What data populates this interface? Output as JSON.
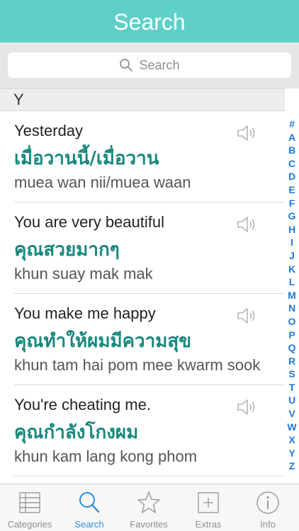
{
  "header": {
    "title": "Search"
  },
  "search": {
    "placeholder": "Search"
  },
  "section": {
    "letter": "Y"
  },
  "rows": [
    {
      "english": "Yesterday",
      "thai": "เมื่อวานนี้/เมื่อวาน",
      "phonetic": "muea wan nii/muea waan",
      "icon": "speaker-icon"
    },
    {
      "english": "You are very beautiful",
      "thai": "คุณสวยมากๆ",
      "phonetic": "khun suay mak mak",
      "icon": "speaker-icon"
    },
    {
      "english": "You make me happy",
      "thai": "คุณทำให้ผมมีความสุข",
      "phonetic": "khun tam hai pom mee kwarm sook",
      "icon": "speaker-icon"
    },
    {
      "english": "You're cheating me.",
      "thai": "คุณกำลังโกงผม",
      "phonetic": "khun kam lang kong phom",
      "icon": "speaker-icon"
    }
  ],
  "index": [
    "#",
    "A",
    "B",
    "C",
    "D",
    "E",
    "F",
    "G",
    "H",
    "I",
    "J",
    "K",
    "L",
    "M",
    "N",
    "O",
    "P",
    "Q",
    "R",
    "S",
    "T",
    "U",
    "V",
    "W",
    "X",
    "Y",
    "Z"
  ],
  "tabs": [
    {
      "label": "Categories",
      "icon": "list-icon",
      "active": false
    },
    {
      "label": "Search",
      "icon": "magnifier-icon",
      "active": true
    },
    {
      "label": "Favorites",
      "icon": "star-icon",
      "active": false
    },
    {
      "label": "Extras",
      "icon": "plus-icon",
      "active": false
    },
    {
      "label": "Info",
      "icon": "info-icon",
      "active": false
    }
  ],
  "colors": {
    "header": "#5fd0c8",
    "thai_text": "#18887d",
    "index": "#1e7ad6",
    "active_tab": "#2a8fdb",
    "inactive_tab": "#8e8e93"
  }
}
